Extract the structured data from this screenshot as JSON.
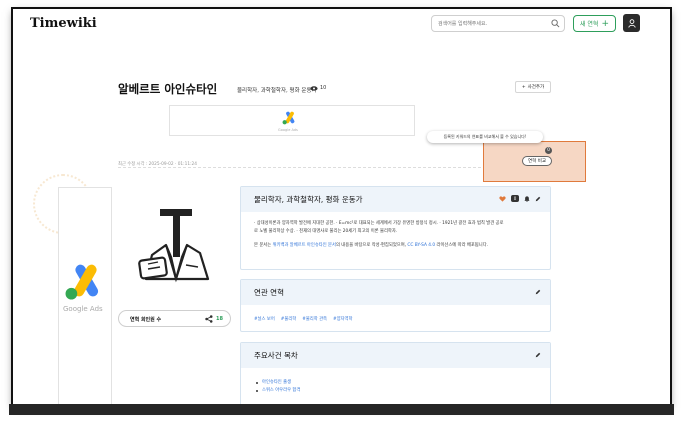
{
  "header": {
    "logo": "Timewiki",
    "search_placeholder": "검색어를 입력해주세요.",
    "new_button_label": "새 연혁",
    "new_button_plus": "+"
  },
  "page": {
    "title": "알베르트 아인슈타인",
    "subtitle": "물리학자, 과학철학자, 평화 운동가",
    "views": "10",
    "add_event_label": "사건추가",
    "tooltip": "등록된 키워드의 연표를 비교해서 볼 수 있습니다!",
    "compare_count": "0",
    "compare_label": "연혁 비교",
    "modified": "최근 수정 시각 : 2025-09-02 · 01:11:24"
  },
  "ads": {
    "banner_label": "Google Ads",
    "side_label": "Google Ads"
  },
  "profile": {
    "follower_label": "연혁 회인원 수",
    "follower_count": "18"
  },
  "card_overview": {
    "title": "물리학자, 과학철학자, 평화 운동가",
    "like_count": "0",
    "line1": "· 상대성이론과 양자역학 발전에 지대한 공헌. · E=mc²로 대표되는 세계에서 가장 유명한 방정식 정시. · 1921년 광전 효과 법칙 발견 공로",
    "line2": "로 노벨 물리학상 수상. · 천재의 대명사로 불리는 20세기 최고의 이론 물리학자.",
    "license_prefix": "본 문서는",
    "license_link": "위키백과 알베르트 아인슈타인 문서",
    "license_middle": "의 내용을 바탕으로 작성·편집되었으며,",
    "license_cc": "CC BY-SA 4.0",
    "license_suffix": "라이선스에 따라 배포됩니다."
  },
  "card_related": {
    "title": "연관 연혁",
    "tags": [
      "#닐스 보어",
      "#물리학",
      "#물리학 관측",
      "#양자역학"
    ]
  },
  "card_toc": {
    "title": "주요사건 목차",
    "items": [
      "아인슈타인 출생",
      "스위스 아우라우 합격"
    ]
  },
  "colors": {
    "accent_green": "#2e9e5b",
    "highlight_orange": "#e07a3c",
    "link_blue": "#2a6fd6",
    "card_header_bg": "#eef4fa"
  }
}
